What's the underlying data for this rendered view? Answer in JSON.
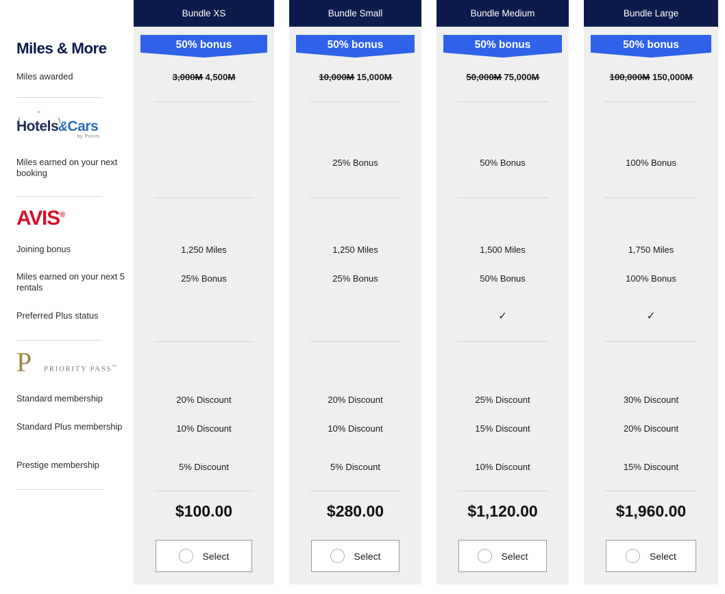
{
  "brands": [
    {
      "id": "miles-and-more",
      "name": "Miles & More",
      "rows": [
        {
          "label": "Miles awarded"
        }
      ]
    },
    {
      "id": "hotels-and-cars",
      "name": "Hotels & Cars",
      "name_part1": "Hotels",
      "name_amp": "&",
      "name_part2": "Cars",
      "tagline": "by Points",
      "rows": [
        {
          "label": "Miles earned on your next booking"
        }
      ]
    },
    {
      "id": "avis",
      "name": "AVIS",
      "trademark": "®",
      "rows": [
        {
          "label": "Joining bonus"
        },
        {
          "label": "Miles earned on your next 5 rentals"
        },
        {
          "label": "Preferred Plus status"
        }
      ]
    },
    {
      "id": "priority-pass",
      "name": "PRIORITY PASS",
      "monogram": "P",
      "trademark": "™",
      "rows": [
        {
          "label": "Standard membership"
        },
        {
          "label": "Standard Plus membership"
        },
        {
          "label": "Prestige membership"
        }
      ]
    }
  ],
  "bundles": [
    {
      "title": "Bundle XS",
      "bonus_banner": "50% bonus",
      "miles_old": "3,000",
      "miles_new": "4,500",
      "mile_symbol": "M",
      "hotels_booking": "",
      "avis_joining_bonus": "1,250 Miles",
      "avis_rentals_bonus": "25% Bonus",
      "avis_preferred_plus": "",
      "pp_standard": "20% Discount",
      "pp_standard_plus": "10% Discount",
      "pp_prestige": "5% Discount",
      "price": "$100.00",
      "select_label": "Select"
    },
    {
      "title": "Bundle Small",
      "bonus_banner": "50% bonus",
      "miles_old": "10,000",
      "miles_new": "15,000",
      "mile_symbol": "M",
      "hotels_booking": "25% Bonus",
      "avis_joining_bonus": "1,250 Miles",
      "avis_rentals_bonus": "25% Bonus",
      "avis_preferred_plus": "",
      "pp_standard": "20% Discount",
      "pp_standard_plus": "10% Discount",
      "pp_prestige": "5% Discount",
      "price": "$280.00",
      "select_label": "Select"
    },
    {
      "title": "Bundle Medium",
      "bonus_banner": "50% bonus",
      "miles_old": "50,000",
      "miles_new": "75,000",
      "mile_symbol": "M",
      "hotels_booking": "50% Bonus",
      "avis_joining_bonus": "1,500 Miles",
      "avis_rentals_bonus": "50% Bonus",
      "avis_preferred_plus": "✓",
      "pp_standard": "25% Discount",
      "pp_standard_plus": "15% Discount",
      "pp_prestige": "10% Discount",
      "price": "$1,120.00",
      "select_label": "Select"
    },
    {
      "title": "Bundle Large",
      "bonus_banner": "50% bonus",
      "miles_old": "100,000",
      "miles_new": "150,000",
      "mile_symbol": "M",
      "hotels_booking": "100% Bonus",
      "avis_joining_bonus": "1,750 Miles",
      "avis_rentals_bonus": "100% Bonus",
      "avis_preferred_plus": "✓",
      "pp_standard": "30% Discount",
      "pp_standard_plus": "20% Discount",
      "pp_prestige": "15% Discount",
      "price": "$1,960.00",
      "select_label": "Select"
    }
  ],
  "colors": {
    "header_navy": "#0d1b4c",
    "bonus_blue": "#2f62e8",
    "column_bg": "#efefef",
    "avis_red": "#d4122b",
    "priority_pass_gold": "#9c8544",
    "hotels_blue": "#2b6cb8"
  }
}
